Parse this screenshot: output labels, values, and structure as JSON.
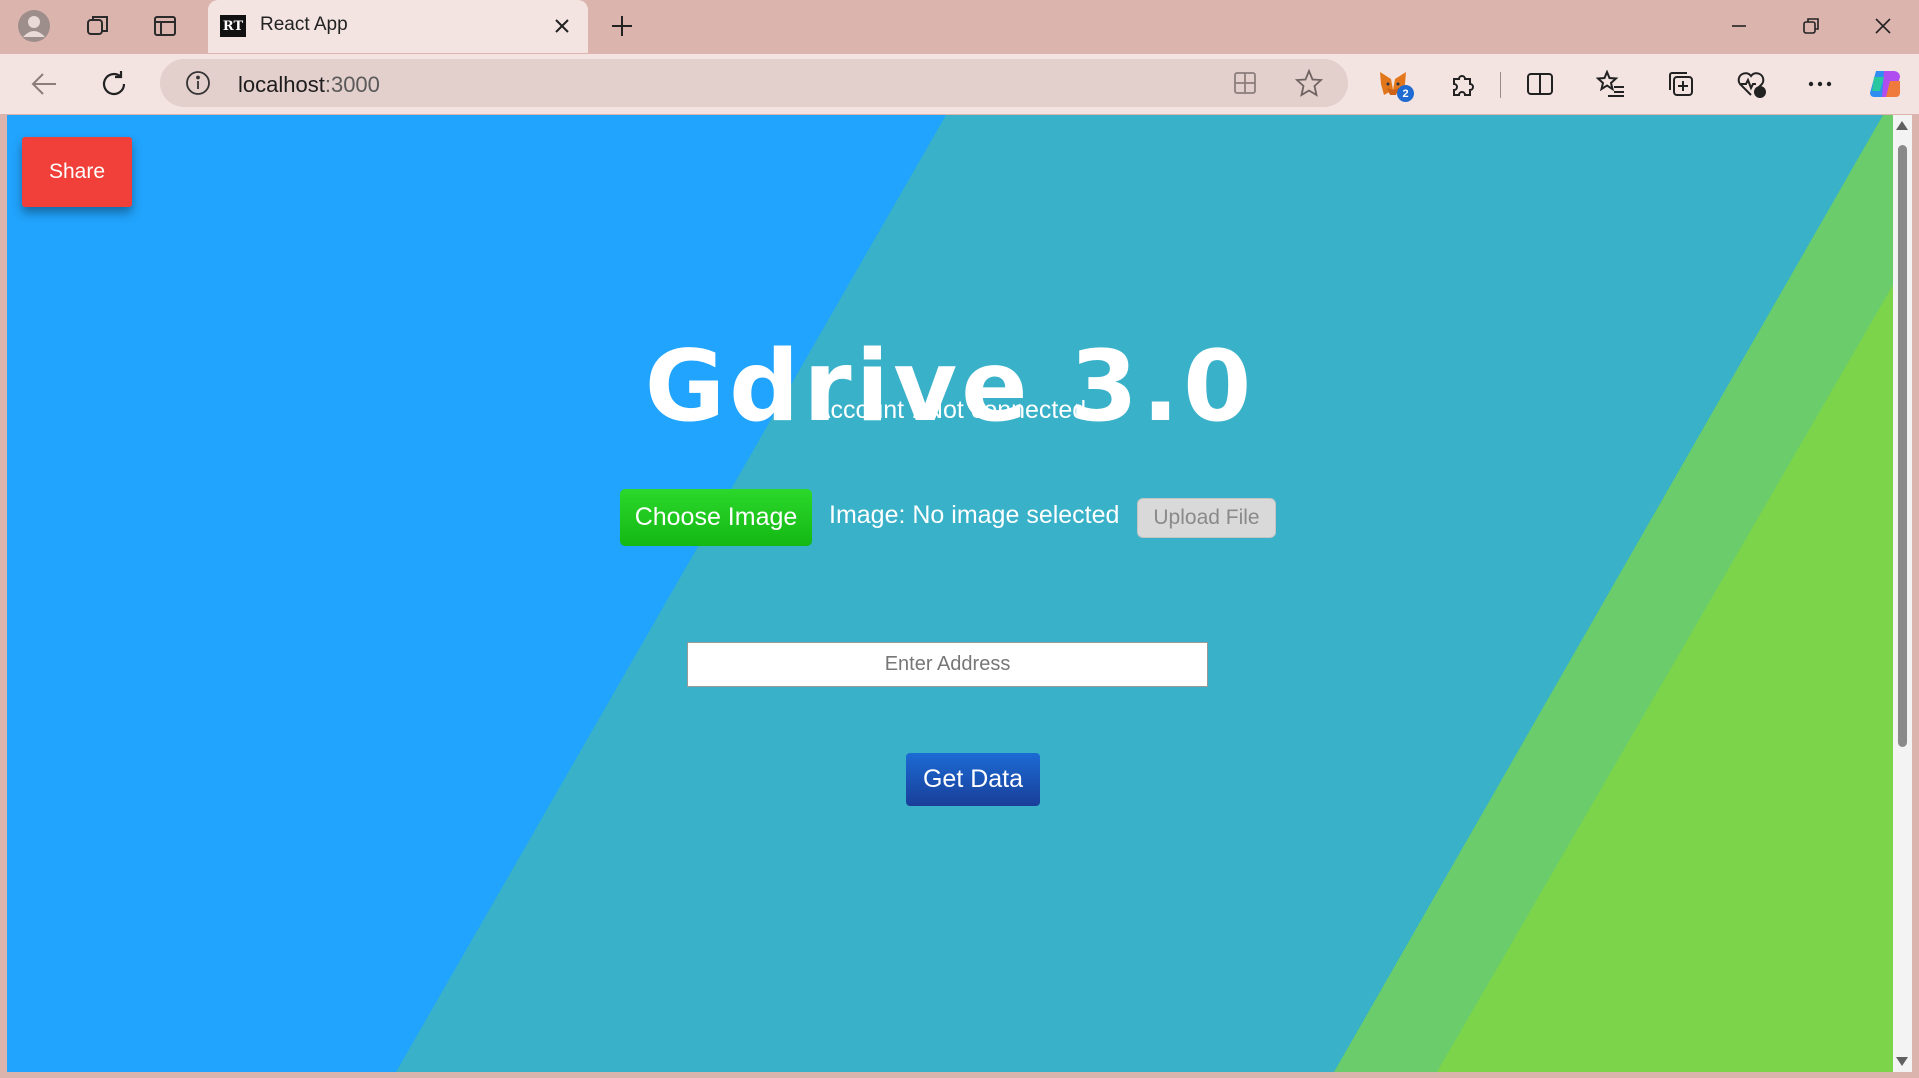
{
  "browser": {
    "tab_title": "React App",
    "tab_favicon_text": "RT",
    "url_host": "localhost",
    "url_port": ":3000",
    "extension_badge": "2"
  },
  "page": {
    "share_label": "Share",
    "title": "Gdrive 3.0",
    "account_text": "Account : Not connected",
    "choose_image_label": "Choose Image",
    "image_status": "Image: No image selected",
    "upload_label": "Upload File",
    "address_placeholder": "Enter Address",
    "address_value": "",
    "get_data_label": "Get Data"
  },
  "colors": {
    "background_blue": "#21a4fd",
    "background_teal": "#38b1c9",
    "background_green_light": "#6acc6a",
    "background_green": "#7cd44a",
    "share_button": "#f1403a",
    "choose_button": "#1fcb1f",
    "get_data_button": "#1b5ec1"
  }
}
